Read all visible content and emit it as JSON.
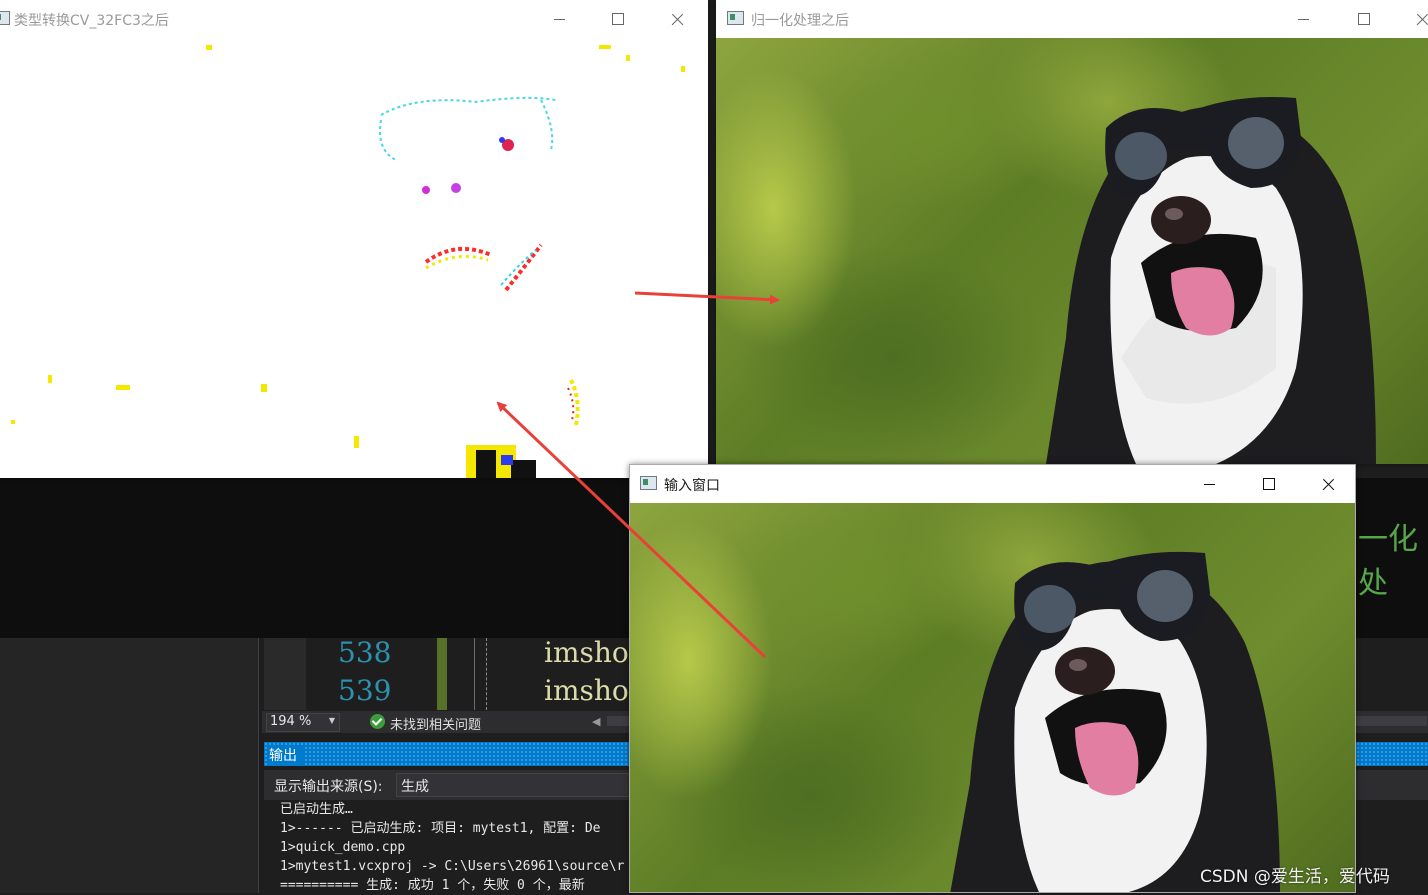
{
  "windows": {
    "cv32": {
      "title": "类型转换CV_32FC3之后"
    },
    "normalized": {
      "title": "归一化处理之后"
    },
    "input": {
      "title": "输入窗口"
    }
  },
  "ide": {
    "editor": {
      "lines": [
        {
          "number": "538",
          "code": "imshow"
        },
        {
          "number": "539",
          "code": "imshow"
        }
      ],
      "partial_text": "一化处"
    },
    "status_bar": {
      "zoom": "194 %",
      "issues": "未找到相关问题"
    },
    "output_panel": {
      "title": "输出",
      "source_label": "显示输出来源(S):",
      "source_value": "生成",
      "lines": [
        "已启动生成…",
        "1>------ 已启动生成: 项目: mytest1, 配置: De",
        "1>quick_demo.cpp",
        "1>mytest1.vcxproj -> C:\\Users\\26961\\source\\r",
        "========== 生成: 成功 1 个，失败 0 个，最新"
      ]
    }
  },
  "watermark": "CSDN @爱生活，爱代码",
  "colors": {
    "annotation_arrow": "#e8413a",
    "output_title_bar": "#007acc",
    "line_number": "#2b91af",
    "code_function": "#dcdcaa"
  }
}
